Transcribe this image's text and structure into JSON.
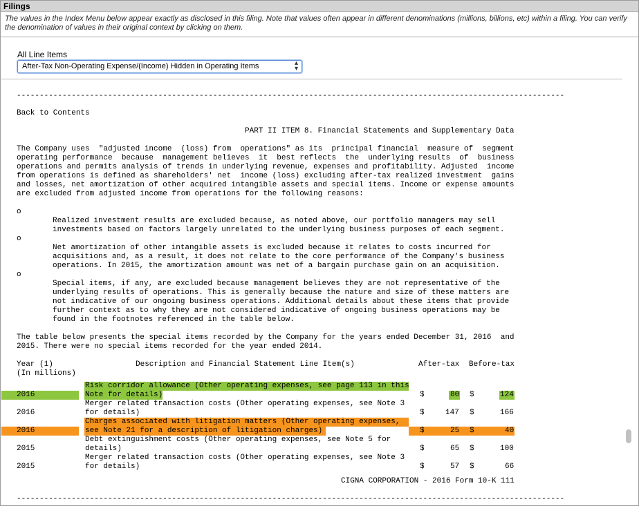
{
  "header": {
    "title": "Filings"
  },
  "note": "The values in the Index Menu below appear exactly as disclosed in this filing. Note that values often appear in different denominations (millions, billions, etc) within a filing. You can verify the denomination of values in their original context by clicking on them.",
  "line_items": {
    "label": "All Line Items",
    "selected": "After-Tax Non-Operating Expense/(Income) Hidden in Operating Items"
  },
  "doc": {
    "rule": "------------------------------------------------------------------------------------------------------------------------",
    "back": "Back to Contents",
    "part_title": "PART II ITEM 8. Financial Statements and Supplementary Data",
    "p1": [
      "The Company uses  \"adjusted income  (loss) from  operations\" as its  principal financial  measure of  segment",
      "operating performance  because  management believes  it  best reflects  the  underlying results  of  business",
      "operations and permits analysis of trends in underlying revenue, expenses and profitability. Adjusted  income",
      "from operations is defined as shareholders' net  income (loss) excluding after-tax realized investment  gains",
      "and losses, net amortization of other acquired intangible assets and special items. Income or expense amounts",
      "are excluded from adjusted income from operations for the following reasons:"
    ],
    "bullet": "o",
    "b1": [
      "Realized investment results are excluded because, as noted above, our portfolio managers may sell",
      "investments based on factors largely unrelated to the underlying business purposes of each segment."
    ],
    "b2": [
      "Net amortization of other intangible assets is excluded because it relates to costs incurred for",
      "acquisitions and, as a result, it does not relate to the core performance of the Company's business",
      "operations. In 2015, the amortization amount was net of a bargain purchase gain on an acquisition."
    ],
    "b3": [
      "Special items, if any, are excluded because management believes they are not representative of the",
      "underlying results of operations. This is generally because the nature and size of these matters are",
      "not indicative of our ongoing business operations. Additional details about these items that provide",
      "further context as to why they are not considered indicative of ongoing business operations may be",
      "found in the footnotes referenced in the table below."
    ],
    "p2": [
      "The table below presents the special items recorded by the Company for the years ended December 31, 2016  and",
      "2015. There were no special items recorded for the year ended 2014."
    ],
    "table": {
      "h_year": "Year (1)",
      "h_units": "(In millions)",
      "h_desc": "Description and Financial Statement Line Item(s)",
      "h_after": "After-tax",
      "h_before": "Before-tax",
      "rows": [
        {
          "year": "2016",
          "desc1": "Risk corridor allowance (Other operating expenses, see page 113 in this",
          "desc2": "Note for details)",
          "after": "80",
          "before": "124"
        },
        {
          "year": "2016",
          "desc1": "Merger related transaction costs (Other operating expenses, see Note 3",
          "desc2": "for details)",
          "after": "147",
          "before": "166"
        },
        {
          "year": "2016",
          "desc1": "Charges associated with litigation matters (Other operating expenses,",
          "desc2": "see Note 21 for a description of litigation charges)",
          "after": "25",
          "before": "40"
        },
        {
          "year": "2015",
          "desc1": "Debt extinguishment costs (Other operating expenses, see Note 5 for",
          "desc2": "details)",
          "after": "65",
          "before": "100"
        },
        {
          "year": "2015",
          "desc1": "Merger related transaction costs (Other operating expenses, see Note 3",
          "desc2": "for details)",
          "after": "57",
          "before": "66"
        }
      ],
      "currency": "$"
    },
    "footer": "CIGNA CORPORATION - 2016 Form 10-K 111"
  },
  "colors": {
    "green_highlight": "#8dc63f",
    "orange_highlight": "#f7941d"
  }
}
